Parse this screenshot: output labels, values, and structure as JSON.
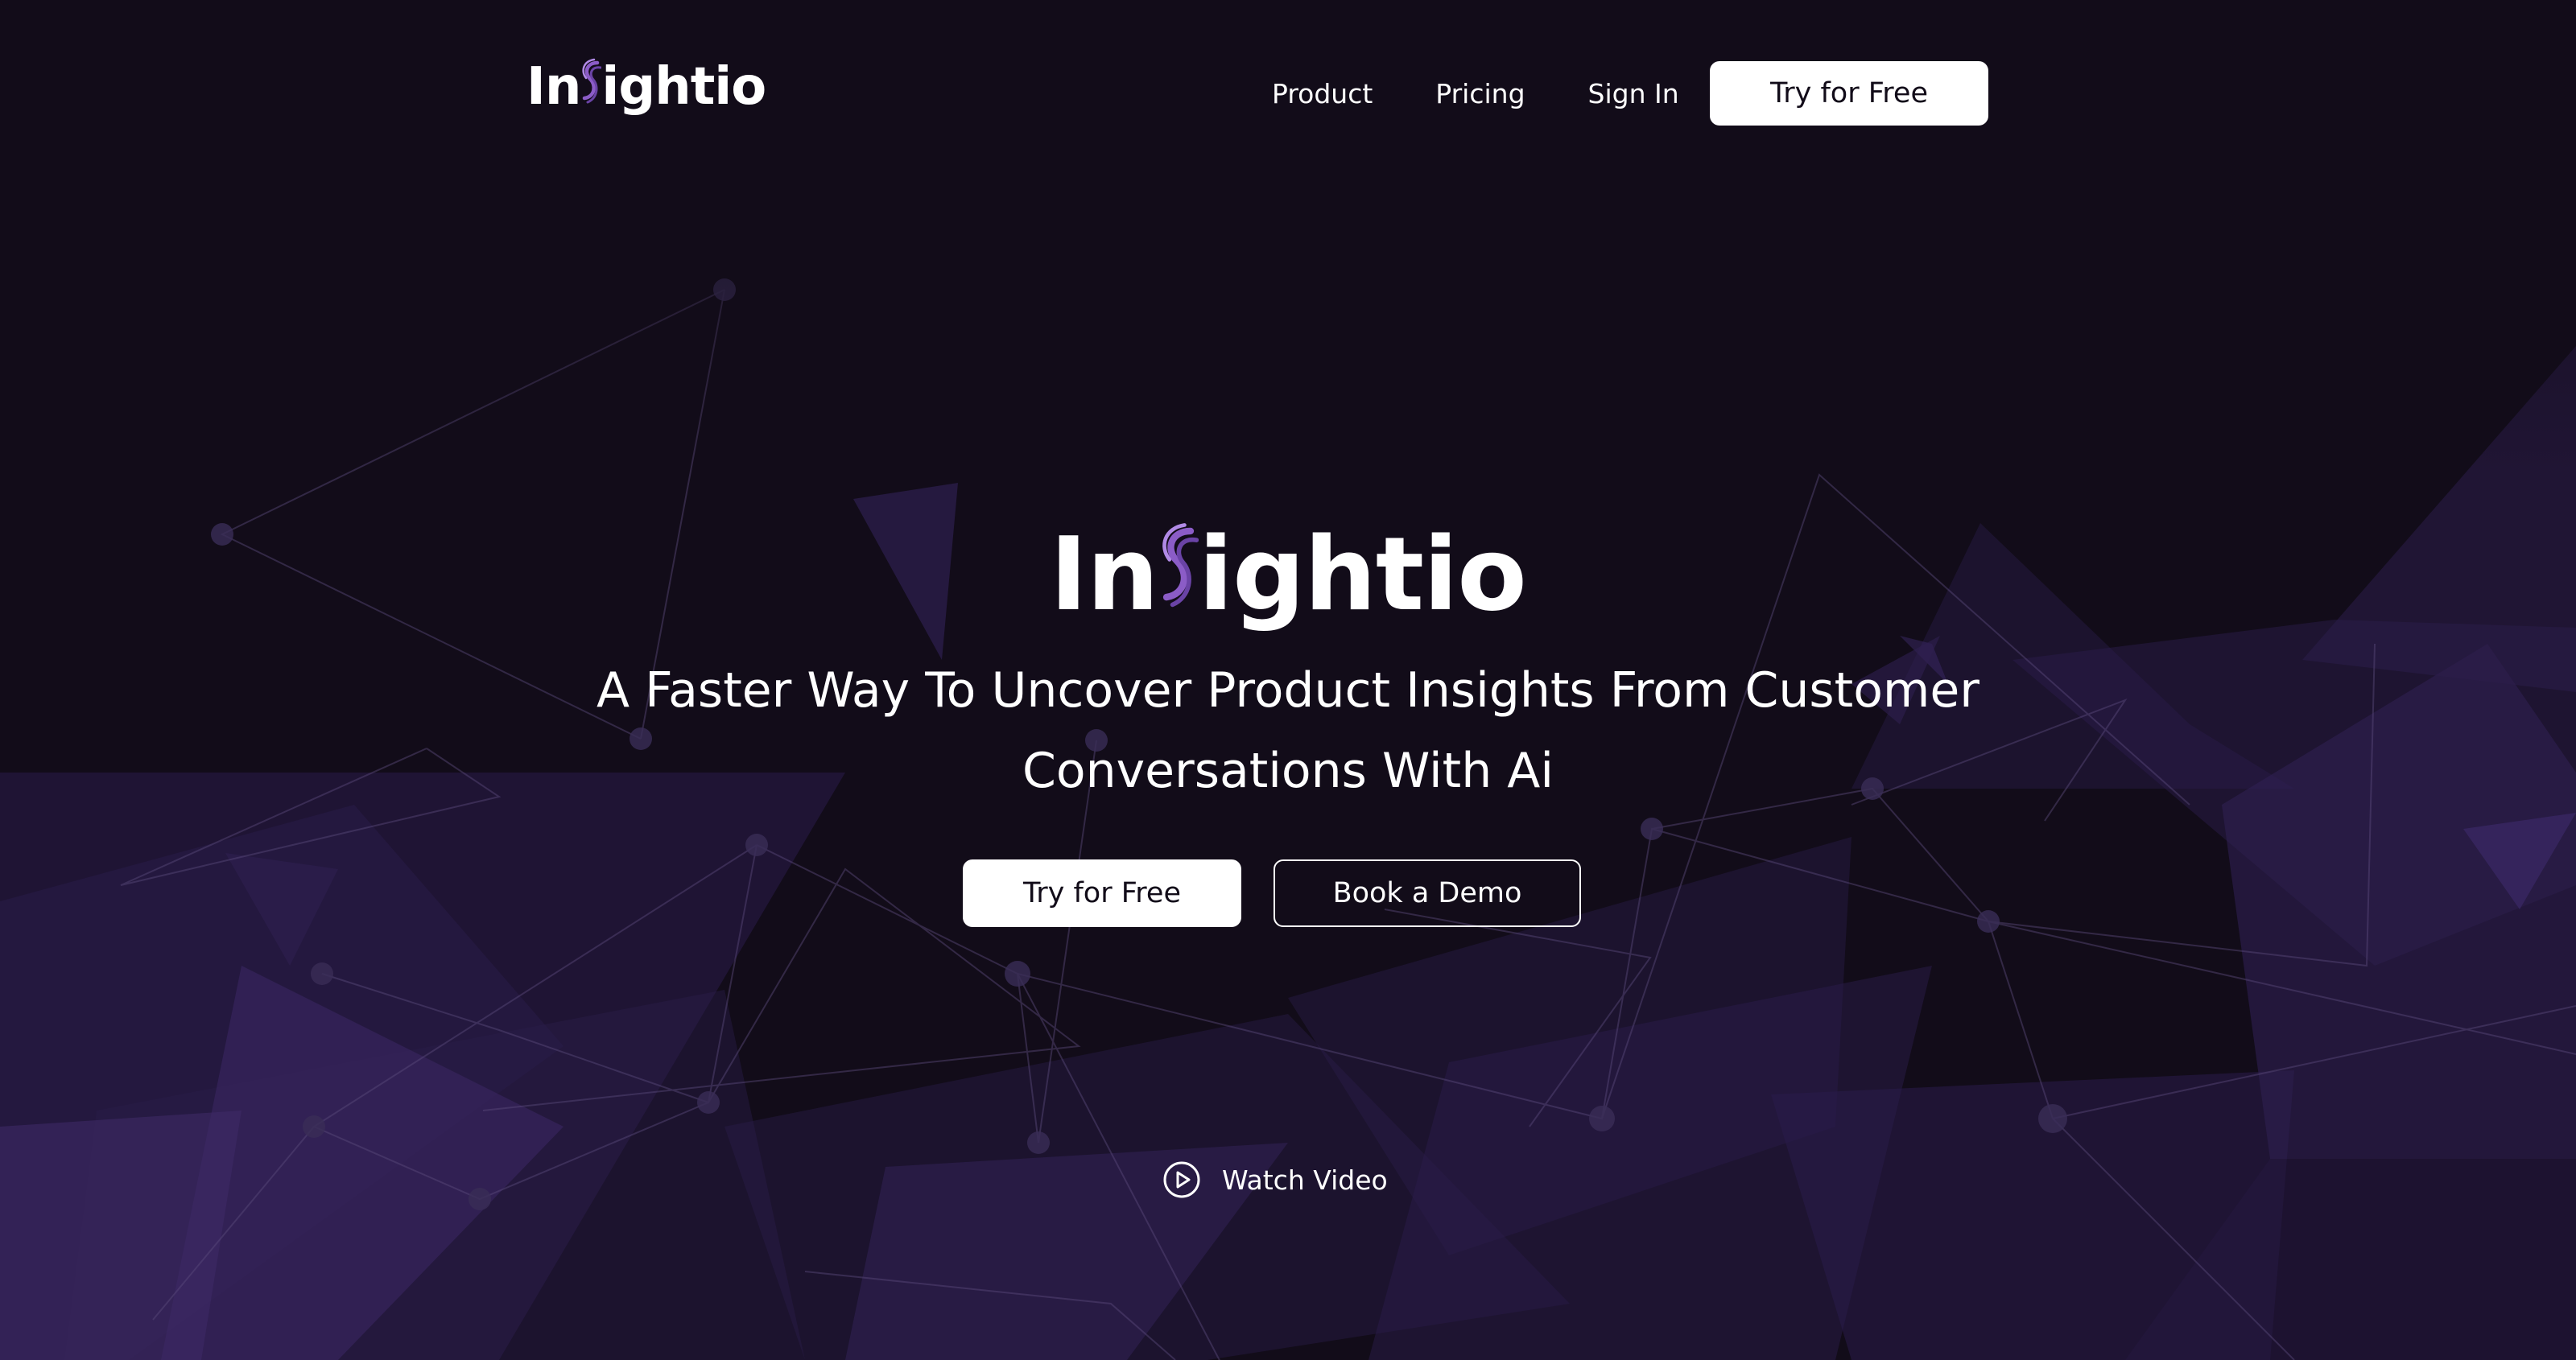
{
  "brand": {
    "name_before": "In",
    "name_after": "ightio",
    "logo_glyph": "fingerprint-s-glyph",
    "accent_color": "#8b5cc7"
  },
  "nav": {
    "links": [
      {
        "label": "Product"
      },
      {
        "label": "Pricing"
      },
      {
        "label": "Sign In"
      }
    ],
    "cta_label": "Try for Free"
  },
  "hero": {
    "subtitle": "A Faster Way To Uncover Product Insights From Customer Conversations With Ai",
    "primary_cta": "Try for Free",
    "secondary_cta": "Book a Demo",
    "video_link": "Watch Video",
    "video_icon": "play-circle-icon"
  },
  "colors": {
    "background": "#120c19",
    "foreground": "#ffffff",
    "polygon": "#2a1c4a"
  }
}
